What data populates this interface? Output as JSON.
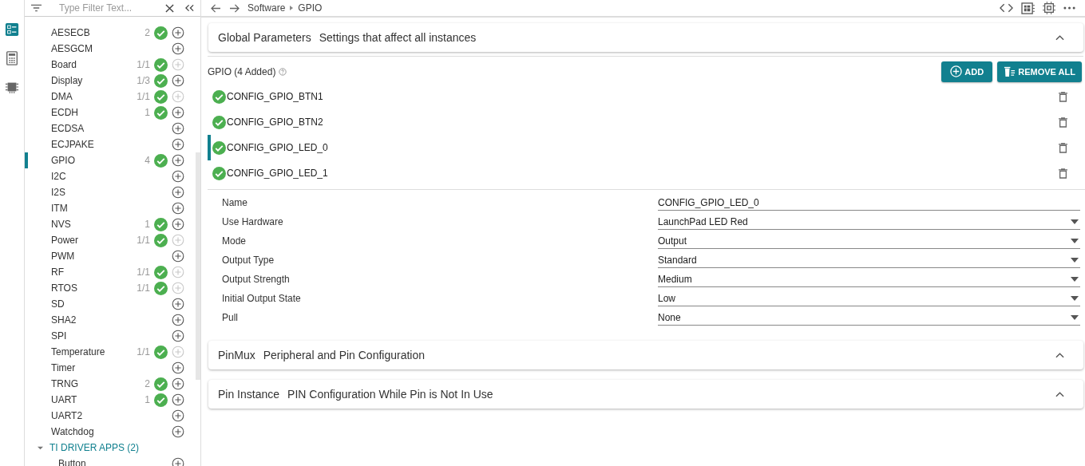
{
  "activity_bar": [
    {
      "kind": "list",
      "selected": true
    },
    {
      "kind": "calculator",
      "selected": false
    },
    {
      "kind": "chip",
      "selected": false
    }
  ],
  "filter": {
    "placeholder": "Type Filter Text..."
  },
  "modules": [
    {
      "name": "AESECB",
      "count": "2",
      "ok": true,
      "add_disabled": false,
      "selected": false
    },
    {
      "name": "AESGCM",
      "ok": false,
      "add_disabled": false,
      "selected": false
    },
    {
      "name": "Board",
      "count": "1/1",
      "ok": true,
      "add_disabled": true,
      "selected": false
    },
    {
      "name": "Display",
      "count": "1/3",
      "ok": true,
      "add_disabled": false,
      "selected": false
    },
    {
      "name": "DMA",
      "count": "1/1",
      "ok": true,
      "add_disabled": true,
      "selected": false
    },
    {
      "name": "ECDH",
      "count": "1",
      "ok": true,
      "add_disabled": false,
      "selected": false
    },
    {
      "name": "ECDSA",
      "ok": false,
      "add_disabled": false,
      "selected": false
    },
    {
      "name": "ECJPAKE",
      "ok": false,
      "add_disabled": false,
      "selected": false
    },
    {
      "name": "GPIO",
      "count": "4",
      "ok": true,
      "add_disabled": false,
      "selected": true
    },
    {
      "name": "I2C",
      "ok": false,
      "add_disabled": false,
      "selected": false
    },
    {
      "name": "I2S",
      "ok": false,
      "add_disabled": false,
      "selected": false
    },
    {
      "name": "ITM",
      "ok": false,
      "add_disabled": false,
      "selected": false
    },
    {
      "name": "NVS",
      "count": "1",
      "ok": true,
      "add_disabled": false,
      "selected": false
    },
    {
      "name": "Power",
      "count": "1/1",
      "ok": true,
      "add_disabled": true,
      "selected": false
    },
    {
      "name": "PWM",
      "ok": false,
      "add_disabled": false,
      "selected": false
    },
    {
      "name": "RF",
      "count": "1/1",
      "ok": true,
      "add_disabled": true,
      "selected": false
    },
    {
      "name": "RTOS",
      "count": "1/1",
      "ok": true,
      "add_disabled": true,
      "selected": false
    },
    {
      "name": "SD",
      "ok": false,
      "add_disabled": false,
      "selected": false
    },
    {
      "name": "SHA2",
      "ok": false,
      "add_disabled": false,
      "selected": false
    },
    {
      "name": "SPI",
      "ok": false,
      "add_disabled": false,
      "selected": false
    },
    {
      "name": "Temperature",
      "count": "1/1",
      "ok": true,
      "add_disabled": true,
      "selected": false
    },
    {
      "name": "Timer",
      "ok": false,
      "add_disabled": false,
      "selected": false
    },
    {
      "name": "TRNG",
      "count": "2",
      "ok": true,
      "add_disabled": false,
      "selected": false
    },
    {
      "name": "UART",
      "count": "1",
      "ok": true,
      "add_disabled": false,
      "selected": false
    },
    {
      "name": "UART2",
      "ok": false,
      "add_disabled": false,
      "selected": false
    },
    {
      "name": "Watchdog",
      "ok": false,
      "add_disabled": false,
      "selected": false
    }
  ],
  "group": {
    "label": "TI DRIVER APPS (2)",
    "expanded": true,
    "children": [
      {
        "name": "Button",
        "ok": false,
        "add_disabled": false,
        "selected": false
      }
    ]
  },
  "breadcrumb": [
    "Software",
    "GPIO"
  ],
  "global_parameters": {
    "title": "Global Parameters",
    "subtitle": "Settings that affect all instances",
    "expanded": true
  },
  "instances_header": {
    "title": "GPIO (4 Added)",
    "add_button": "ADD",
    "remove_all_button": "REMOVE ALL"
  },
  "instances": [
    {
      "name": "CONFIG_GPIO_BTN1",
      "ok": true,
      "selected": false
    },
    {
      "name": "CONFIG_GPIO_BTN2",
      "ok": true,
      "selected": false
    },
    {
      "name": "CONFIG_GPIO_LED_0",
      "ok": true,
      "selected": true
    },
    {
      "name": "CONFIG_GPIO_LED_1",
      "ok": true,
      "selected": false
    }
  ],
  "properties": [
    {
      "label": "Name",
      "kind": "text",
      "value": "CONFIG_GPIO_LED_0"
    },
    {
      "label": "Use Hardware",
      "kind": "select",
      "value": "LaunchPad LED Red"
    },
    {
      "label": "Mode",
      "kind": "select",
      "value": "Output"
    },
    {
      "label": "Output Type",
      "kind": "select",
      "value": "Standard"
    },
    {
      "label": "Output Strength",
      "kind": "select",
      "value": "Medium"
    },
    {
      "label": "Initial Output State",
      "kind": "select",
      "value": "Low"
    },
    {
      "label": "Pull",
      "kind": "select",
      "value": "None"
    }
  ],
  "sections": [
    {
      "title": "PinMux",
      "subtitle": "Peripheral and Pin Configuration",
      "expanded": true
    },
    {
      "title": "Pin Instance",
      "subtitle": "PIN Configuration While Pin is Not In Use",
      "expanded": true
    }
  ]
}
